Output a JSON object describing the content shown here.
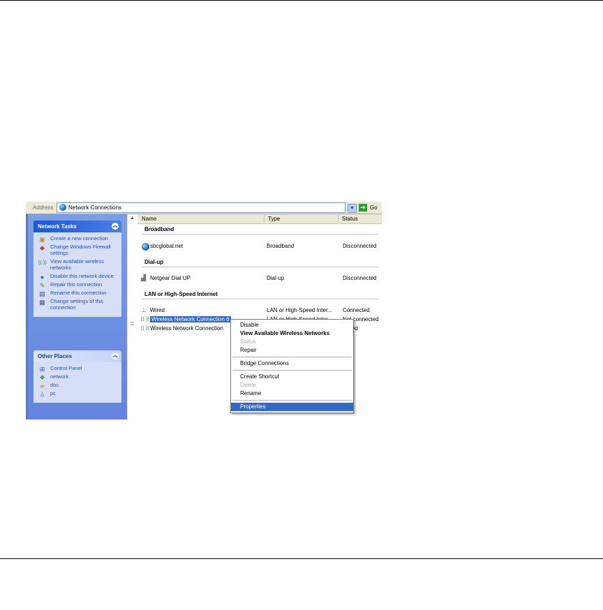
{
  "address_bar": {
    "label": "Address",
    "location": "Network Connections",
    "go_label": "Go"
  },
  "sidebar": {
    "network_tasks": {
      "title": "Network Tasks",
      "items": [
        {
          "label": "Create a new connection",
          "icon": "new-connection-icon"
        },
        {
          "label": "Change Windows Firewall settings",
          "icon": "firewall-icon"
        },
        {
          "label": "View available wireless networks",
          "icon": "wireless-icon"
        },
        {
          "label": "Disable this network device",
          "icon": "disable-icon"
        },
        {
          "label": "Repair this connection",
          "icon": "repair-icon"
        },
        {
          "label": "Rename this connection",
          "icon": "rename-icon"
        },
        {
          "label": "Change settings of this connection",
          "icon": "settings-icon"
        }
      ]
    },
    "other_places": {
      "title": "Other Places",
      "items": [
        {
          "label": "Control Panel",
          "icon": "control-panel-icon"
        },
        {
          "label": "network",
          "icon": "network-icon"
        },
        {
          "label": "doc",
          "icon": "folder-icon"
        },
        {
          "label": "pc",
          "icon": "computer-icon"
        }
      ]
    }
  },
  "columns": {
    "name": "Name",
    "type": "Type",
    "status": "Status"
  },
  "groups": {
    "broadband": "Broadband",
    "dialup": "Dial-up",
    "lan": "LAN or High-Speed Internet"
  },
  "rows": {
    "sbcglobal": {
      "name": "sbcglobal.net",
      "type": "Broadband",
      "status": "Disconnected"
    },
    "netgear": {
      "name": "Netgear Dial UP",
      "type": "Dial-up",
      "status": "Disconnected"
    },
    "wired": {
      "name": "Wired",
      "type": "LAN or High-Speed Inter...",
      "status": "Connected"
    },
    "wnc6": {
      "name": "Wireless Network Connection 6",
      "type": "LAN or High-Speed Inter...",
      "status": "Not connected"
    },
    "wnc": {
      "name": "Wireless Network Connection",
      "type": "",
      "status": "...bled"
    }
  },
  "context_menu": {
    "disable": "Disable",
    "view_wireless": "View Available Wireless Networks",
    "status": "Status",
    "repair": "Repair",
    "bridge": "Bridge Connections",
    "create_shortcut": "Create Shortcut",
    "delete": "Delete",
    "rename": "Rename",
    "properties": "Properties"
  },
  "colors": {
    "selection": "#316ac5",
    "task_link": "#214fb5",
    "panel_bg": "#6383e0"
  }
}
